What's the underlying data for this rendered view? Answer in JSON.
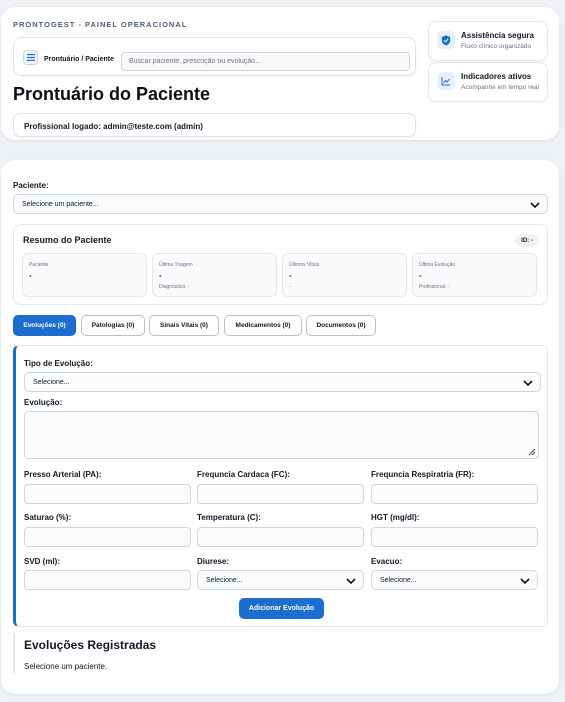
{
  "header": {
    "eyebrow": "PRONTOGEST - PAINEL OPERACIONAL",
    "breadcrumb": "Prontuário / Paciente",
    "search_placeholder": "Buscar paciente, prescrição ou evolução...",
    "title": "Prontuário do Paciente",
    "logged_user": "Profissional logado: admin@teste.com (admin)"
  },
  "side_cards": [
    {
      "title": "Assistência segura",
      "subtitle": "Fluxo clínico organizado",
      "icon": "shield-icon"
    },
    {
      "title": "Indicadores ativos",
      "subtitle": "Acompanhe em tempo real",
      "icon": "chart-icon"
    }
  ],
  "patient": {
    "label": "Paciente:",
    "select_value": "Selecione um paciente..."
  },
  "resumo": {
    "title": "Resumo do Paciente",
    "id_badge": "ID: -",
    "cells": [
      {
        "label": "Paciente",
        "value": "-",
        "sub": ""
      },
      {
        "label": "Última Triagem",
        "value": "-",
        "sub": "Diagnóstico: -"
      },
      {
        "label": "Últimos Vitais",
        "value": "-",
        "sub": "-"
      },
      {
        "label": "Última Evolução",
        "value": "-",
        "sub": "Profissional: -"
      }
    ]
  },
  "tabs": [
    {
      "label": "Evoluções (0)",
      "active": true
    },
    {
      "label": "Patologias (0)",
      "active": false
    },
    {
      "label": "Sinais Vitais (0)",
      "active": false
    },
    {
      "label": "Medicamentos (0)",
      "active": false
    },
    {
      "label": "Documentos (0)",
      "active": false
    }
  ],
  "evolution_form": {
    "tipo_label": "Tipo de Evolução:",
    "tipo_value": "Selecione...",
    "evolucao_label": "Evolução:",
    "fields": [
      {
        "label": "Presso Arterial (PA):"
      },
      {
        "label": "Frequncia Cardaca (FC):"
      },
      {
        "label": "Frequncia Respiratria (FR):"
      },
      {
        "label": "Saturao (%):"
      },
      {
        "label": "Temperatura (C):"
      },
      {
        "label": "HGT (mg/dl):"
      },
      {
        "label": "SVD (ml):"
      },
      {
        "label": "Diurese:",
        "select_value": "Selecione..."
      },
      {
        "label": "Evacuo:",
        "select_value": "Selecione..."
      }
    ],
    "submit_label": "Adicionar Evolução"
  },
  "registered": {
    "title": "Evoluções Registradas",
    "empty_text": "Selecione um paciente."
  },
  "colors": {
    "accent": "#1c6dd0",
    "background": "#eef1f6"
  }
}
